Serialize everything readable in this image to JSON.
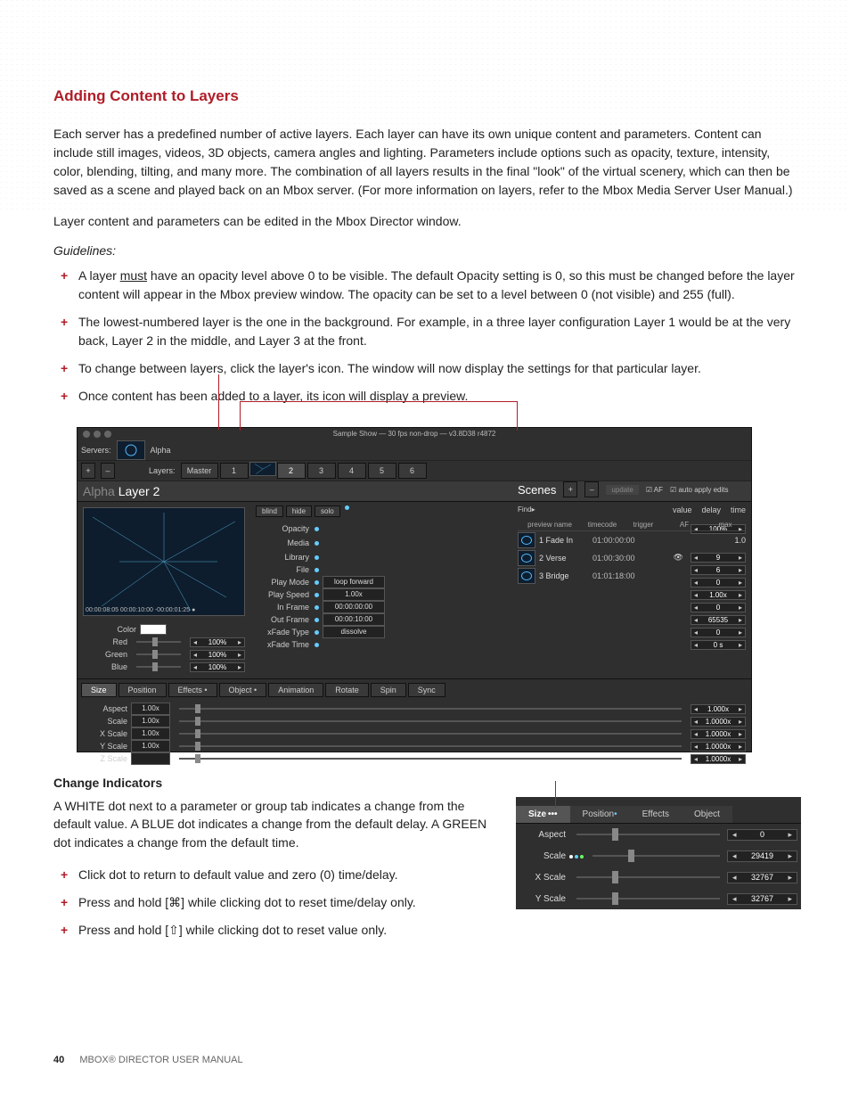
{
  "section_title": "Adding Content to Layers",
  "para1": "Each server has a predefined number of active layers. Each layer can have its own unique content and parameters. Content can include still images, videos, 3D objects, camera angles and lighting. Parameters include options such as opacity, texture, intensity, color, blending, tilting, and many more. The combination of all layers results in the final \"look\" of the virtual scenery, which can then be saved as a scene and played back on an Mbox server. (For more information on layers, refer to the Mbox Media Server User Manual.)",
  "para2": "Layer content and parameters can be edited in the Mbox Director window.",
  "guidelines_label": "Guidelines:",
  "guidelines": [
    {
      "pre": "A layer ",
      "u": "must",
      "post": " have an opacity level above 0 to be visible. The default Opacity setting is 0, so this must be changed before the layer content will appear in the Mbox preview window. The opacity can be set to a level between 0 (not visible) and 255 (full)."
    },
    {
      "text": "The lowest-numbered layer is the one in the background. For example, in a three layer configuration Layer 1 would be at the very back, Layer 2 in the middle, and Layer 3 at the front."
    },
    {
      "text": "To change between layers, click the layer's icon. The window will now display the settings for that particular layer."
    },
    {
      "text": "Once content has been added to a layer, its icon will display a preview."
    }
  ],
  "shot": {
    "title": "Sample Show  —  30 fps non-drop  —  v3.8D38 r4872",
    "servers_label": "Servers:",
    "layers_label": "Layers:",
    "server_name": "Alpha",
    "plus": "+",
    "minus": "–",
    "layer_tabs": [
      "Master",
      "1",
      "2",
      "3",
      "4",
      "5",
      "6"
    ],
    "active_tab": 2,
    "layer_title_dim": "Alpha ",
    "layer_title": "Layer 2",
    "buttons": {
      "blind": "blind",
      "hide": "hide",
      "solo": "solo"
    },
    "hdr": {
      "value": "value",
      "delay": "delay",
      "time": "time"
    },
    "opacity": {
      "label": "Opacity",
      "value": "100%"
    },
    "prevtc": "00:00:08:05   00:00:10:00  -00:00:01:25 ●",
    "media_group": "Media",
    "params": [
      {
        "n": "Library",
        "val": "9",
        "eye": true
      },
      {
        "n": "File",
        "val": "6"
      },
      {
        "n": "Play Mode",
        "box": "loop forward",
        "val": "0"
      },
      {
        "n": "Play Speed",
        "box": "1.00x",
        "val": "1.00x"
      },
      {
        "n": "In Frame",
        "box": "00:00:00:00",
        "val": "0"
      },
      {
        "n": "Out Frame",
        "box": "00:00:10:00",
        "val": "65535"
      },
      {
        "n": "xFade Type",
        "box": "dissolve",
        "val": "0"
      },
      {
        "n": "xFade Time",
        "val": "0 s"
      }
    ],
    "color": {
      "label": "Color",
      "rows": [
        {
          "n": "Red",
          "v": "100%"
        },
        {
          "n": "Green",
          "v": "100%"
        },
        {
          "n": "Blue",
          "v": "100%"
        }
      ]
    },
    "tabs2": [
      "Size",
      "Position",
      "Effects •",
      "Object •",
      "Animation",
      "Rotate",
      "Spin",
      "Sync"
    ],
    "size_rows": [
      {
        "n": "Aspect",
        "s": "1.00x",
        "v": "1.000x"
      },
      {
        "n": "Scale",
        "s": "1.00x",
        "v": "1.0000x"
      },
      {
        "n": "X Scale",
        "s": "1.00x",
        "v": "1.0000x"
      },
      {
        "n": "Y Scale",
        "s": "1.00x",
        "v": "1.0000x"
      },
      {
        "n": "Z Scale",
        "s": "",
        "v": "1.0000x"
      }
    ],
    "scenes": {
      "title": "Scenes",
      "find": "Find▸",
      "af": "AF",
      "auto": "auto apply edits",
      "update": "update",
      "cols": [
        "preview name",
        "timecode",
        "trigger",
        "AF",
        "max"
      ],
      "rows": [
        {
          "n": "1 Fade In",
          "tc": "01:00:00:00",
          "max": "1.0"
        },
        {
          "n": "2 Verse",
          "tc": "01:00:30:00",
          "max": ""
        },
        {
          "n": "3 Bridge",
          "tc": "01:01:18:00",
          "max": ""
        }
      ]
    }
  },
  "ci": {
    "heading": "Change Indicators",
    "para": "A WHITE dot next to a parameter or group tab indicates a change from the default value. A BLUE dot indicates a change from the default delay. A GREEN dot indicates a change from the default time.",
    "items": [
      "Click dot to return to default value and zero (0) time/delay.",
      "Press and hold [⌘] while clicking dot to reset time/delay only.",
      "Press and hold [⇧] while clicking dot to reset value only."
    ],
    "tabs": [
      "Size",
      "Position",
      "Effects",
      "Object"
    ],
    "size_dots": "•••",
    "pos_dot": "•",
    "rows": [
      {
        "n": "Aspect",
        "v": "0"
      },
      {
        "n": "Scale",
        "v": "29419",
        "dots": true
      },
      {
        "n": "X Scale",
        "v": "32767"
      },
      {
        "n": "Y Scale",
        "v": "32767"
      }
    ]
  },
  "footer": {
    "page": "40",
    "book": "MBOX® DIRECTOR USER MANUAL"
  }
}
